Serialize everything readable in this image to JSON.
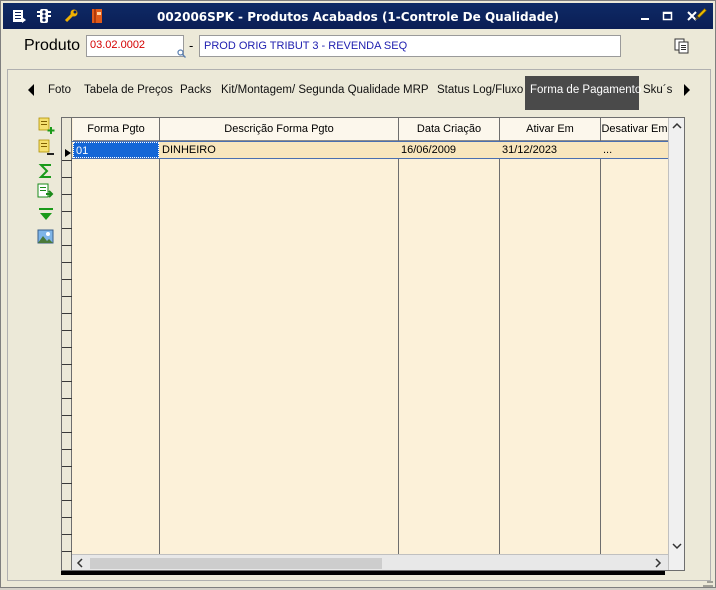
{
  "window": {
    "title": "002006SPK - Produtos Acabados (1-Controle De Qualidade)",
    "titlebar_color": "#0b1e55",
    "left_icons": [
      "menu-icon",
      "traffic-light-icon",
      "wrench-icon",
      "book-icon"
    ],
    "right_icons": [
      "minimize-icon",
      "restore-icon",
      "close-icon",
      "pencil-icon"
    ]
  },
  "produto": {
    "label": "Produto",
    "code": "03.02.0002",
    "separator": "-",
    "description": "PROD ORIG TRIBUT 3 - REVENDA SEQ",
    "code_color": "#d40000",
    "description_color": "#2020b0"
  },
  "tabs": {
    "items": [
      {
        "label": "Foto"
      },
      {
        "label": "Tabela de Preços"
      },
      {
        "label": "Packs"
      },
      {
        "label": "Kit/Montagem/ Segunda Qualidade"
      },
      {
        "label": "MRP"
      },
      {
        "label": "Status Log/Fluxo"
      },
      {
        "label": "Forma de Pagamento",
        "active": true
      },
      {
        "label": "Sku´s"
      }
    ],
    "active_bg": "#4a4a4a"
  },
  "toolbar": {
    "icons": [
      "add-record-icon",
      "delete-record-icon",
      "sum-icon",
      "export-icon",
      "filter-icon",
      "image-icon"
    ]
  },
  "grid": {
    "columns": [
      "Forma Pgto",
      "Descrição Forma Pgto",
      "Data Criação",
      "Ativar Em",
      "Desativar Em"
    ],
    "rows": [
      {
        "forma_pgto": "01",
        "descricao": "DINHEIRO",
        "data_criacao": "16/06/2009",
        "ativar_em": "31/12/2023",
        "desativar_em": "..."
      }
    ],
    "row_bg": "#f8e6bd",
    "grid_bg": "#fcf1d9",
    "selection_color": "#1466d6"
  }
}
